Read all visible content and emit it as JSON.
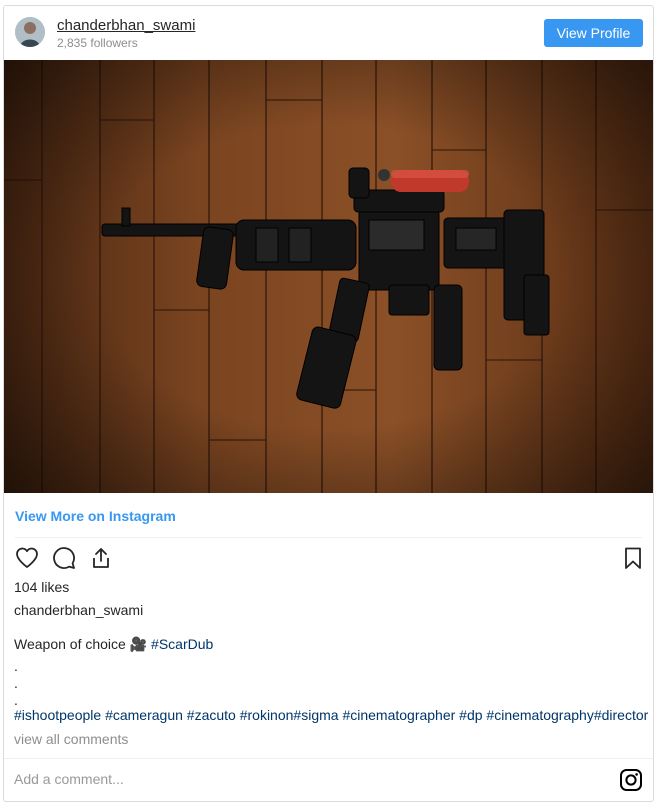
{
  "header": {
    "username": "chanderbhan_swami",
    "followers": "2,835 followers",
    "view_profile_label": "View Profile"
  },
  "post": {
    "view_more_label": "View More on Instagram",
    "likes": "104 likes",
    "owner": "chanderbhan_swami",
    "caption_text": "Weapon of choice",
    "caption_emoji": "🎥",
    "caption_tag": "#ScarDub",
    "dots": [
      ".",
      ".",
      "."
    ],
    "hashtags": "#ishootpeople #cameragun #zacuto #rokinon#sigma #cinematographer #dp #cinematography#director",
    "view_all_comments": "view all comments"
  },
  "comment_box": {
    "placeholder": "Add a comment..."
  },
  "colors": {
    "accent": "#3897f0",
    "hashtag": "#003569",
    "muted": "#8e8e8e"
  },
  "icons": {
    "like": "heart-icon",
    "comment": "comment-icon",
    "share": "share-icon",
    "save": "bookmark-icon",
    "brand": "instagram-icon"
  }
}
